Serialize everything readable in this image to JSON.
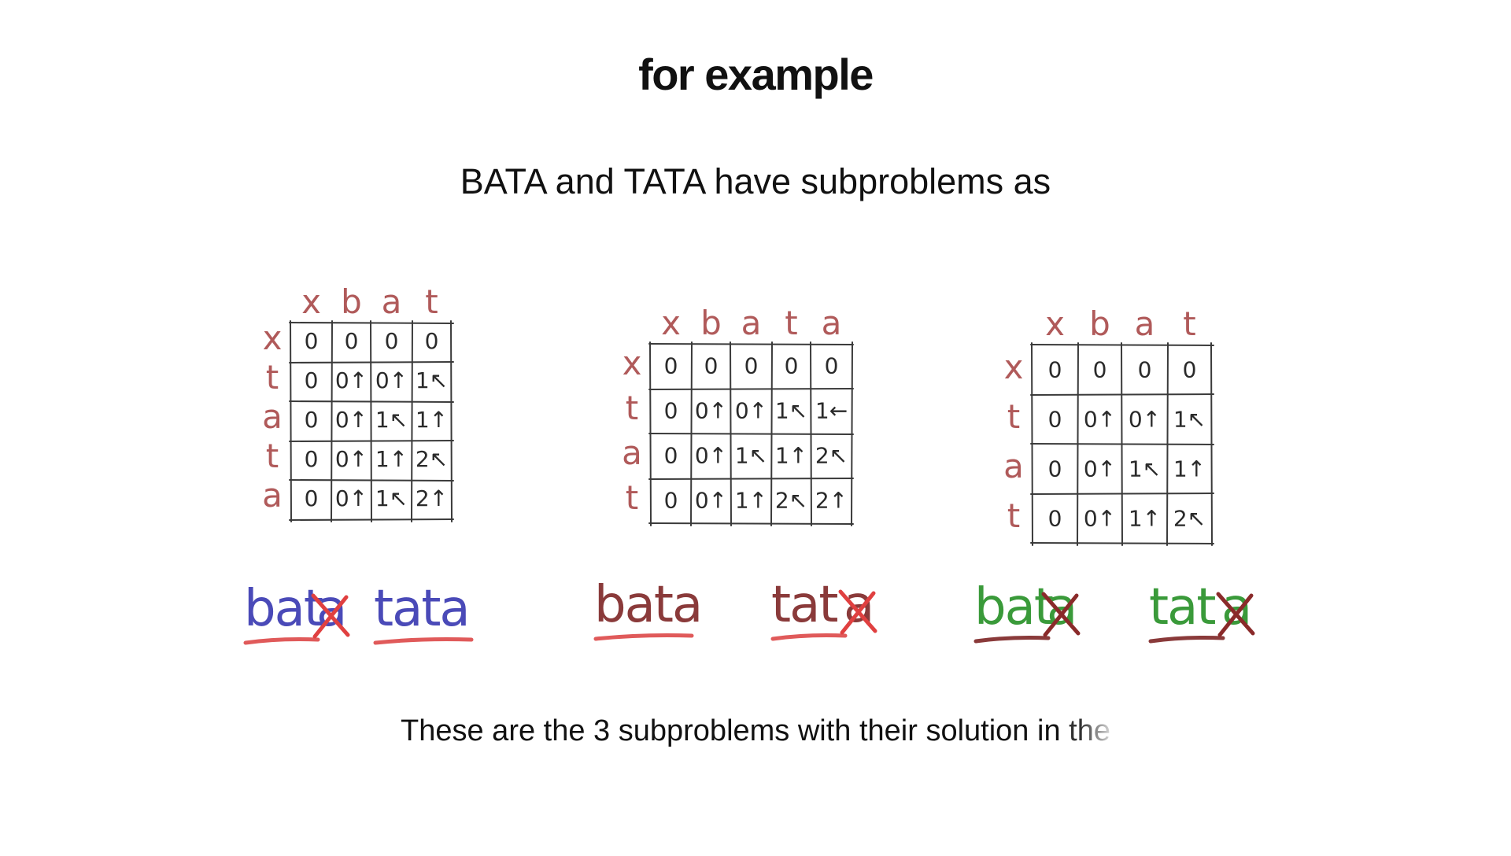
{
  "header": {
    "title": "for example",
    "subtitle": "BATA and TATA have subproblems as"
  },
  "caption": {
    "main": "These are the 3 subproblems with their solution in ",
    "fading": "the"
  },
  "colors": {
    "label": "#b05a5a",
    "grid": "#3a3a3a",
    "underline": "#e05a5a",
    "cross": "#e04040",
    "panel1_word": "#4a4ab8",
    "panel2_word": "#8a3a3a",
    "panel3_word": "#3a9a3a",
    "panel3_underline": "#8a3a3a",
    "panel3_cross": "#8a2a2a"
  },
  "panels": [
    {
      "cols": [
        "x",
        "b",
        "a",
        "t"
      ],
      "rows": [
        "x",
        "t",
        "a",
        "t",
        "a"
      ],
      "cells": [
        [
          "0",
          "0",
          "0",
          "0"
        ],
        [
          "0",
          "0↑",
          "0↑",
          "1↖"
        ],
        [
          "0",
          "0↑",
          "1↖",
          "1↑"
        ],
        [
          "0",
          "0↑",
          "1↑",
          "2↖"
        ],
        [
          "0",
          "0↑",
          "1↖",
          "2↑"
        ]
      ],
      "word_left": "bat",
      "word_left_struck": "a",
      "word_right": "tata",
      "word_right_struck": ""
    },
    {
      "cols": [
        "x",
        "b",
        "a",
        "t",
        "a"
      ],
      "rows": [
        "x",
        "t",
        "a",
        "t"
      ],
      "cells": [
        [
          "0",
          "0",
          "0",
          "0",
          "0"
        ],
        [
          "0",
          "0↑",
          "0↑",
          "1↖",
          "1←"
        ],
        [
          "0",
          "0↑",
          "1↖",
          "1↑",
          "2↖"
        ],
        [
          "0",
          "0↑",
          "1↑",
          "2↖",
          "2↑"
        ]
      ],
      "word_left": "bata",
      "word_left_struck": "",
      "word_right": "tat",
      "word_right_struck": "a"
    },
    {
      "cols": [
        "x",
        "b",
        "a",
        "t"
      ],
      "rows": [
        "x",
        "t",
        "a",
        "t"
      ],
      "cells": [
        [
          "0",
          "0",
          "0",
          "0"
        ],
        [
          "0",
          "0↑",
          "0↑",
          "1↖"
        ],
        [
          "0",
          "0↑",
          "1↖",
          "1↑"
        ],
        [
          "0",
          "0↑",
          "1↑",
          "2↖"
        ]
      ],
      "word_left": "bat",
      "word_left_struck": "a",
      "word_right": "tat",
      "word_right_struck": "a"
    }
  ]
}
